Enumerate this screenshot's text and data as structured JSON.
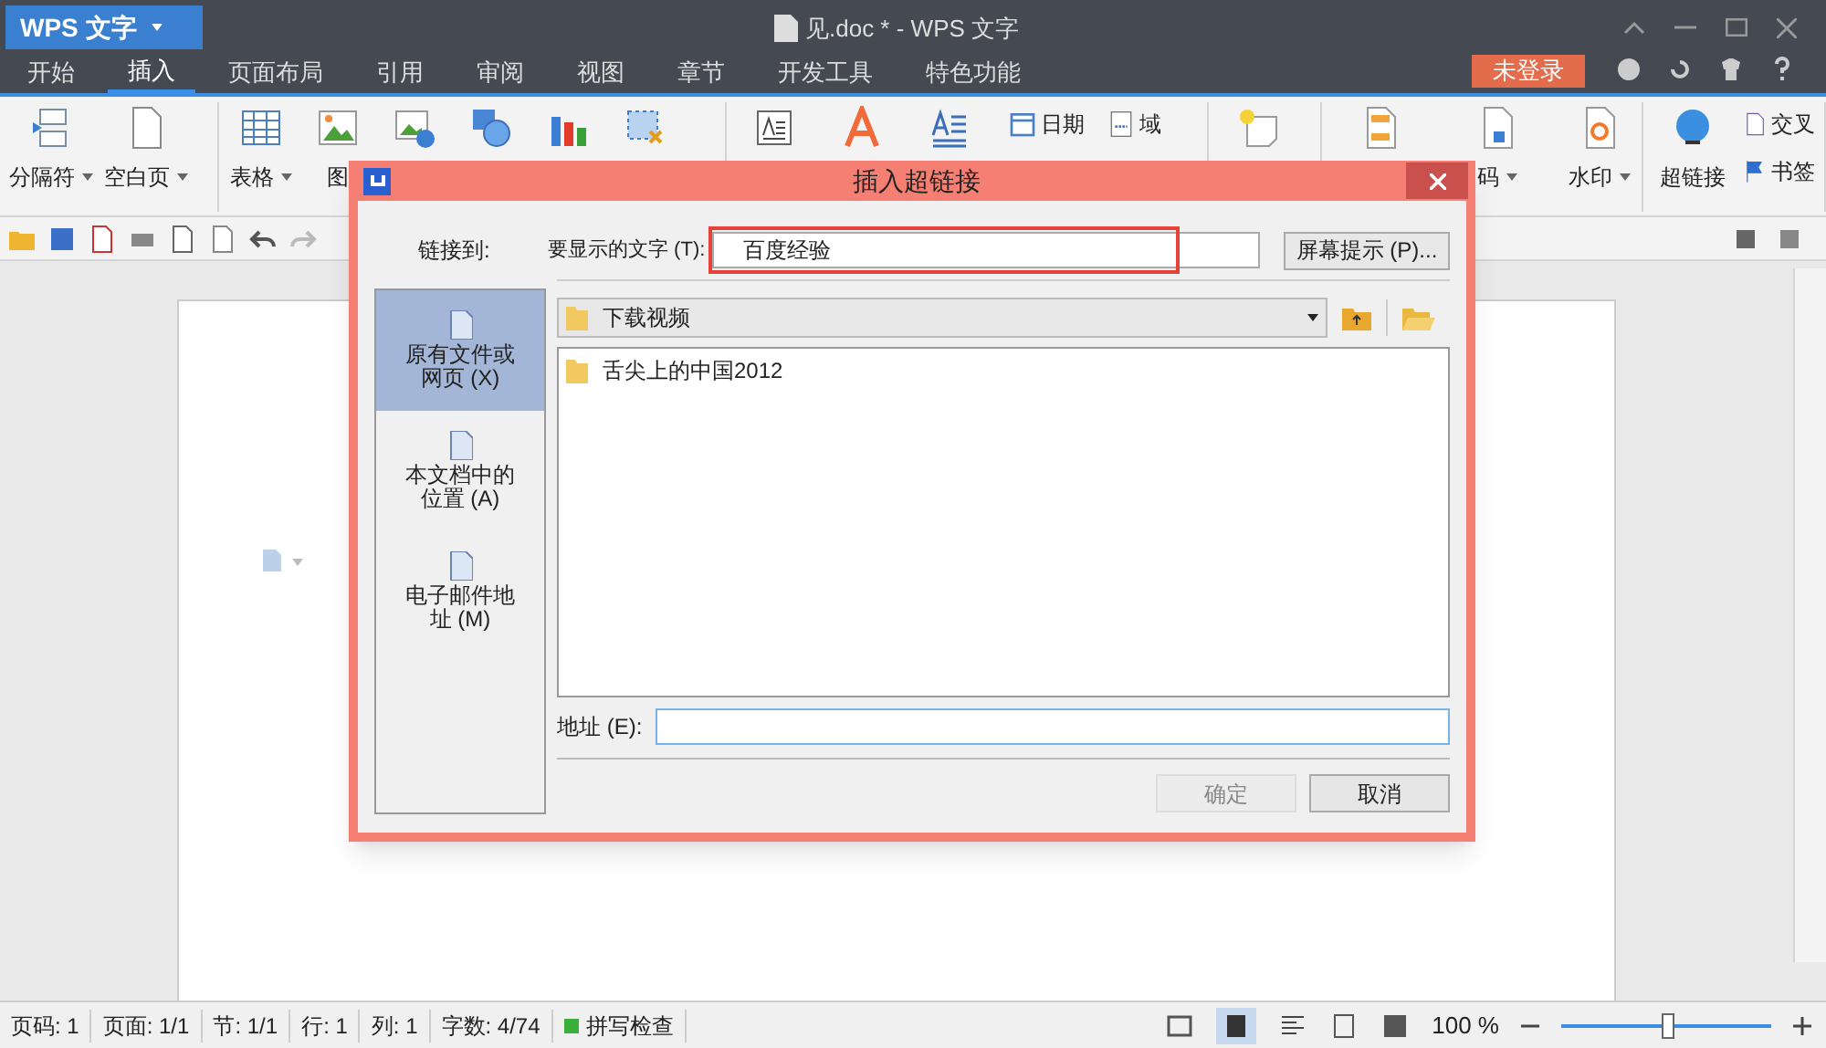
{
  "app": {
    "menu_button": "WPS 文字",
    "title": "见.doc * - WPS 文字",
    "login": "未登录"
  },
  "tabs": [
    {
      "label": "开始",
      "selected": false
    },
    {
      "label": "插入",
      "selected": true
    },
    {
      "label": "页面布局",
      "selected": false
    },
    {
      "label": "引用",
      "selected": false
    },
    {
      "label": "审阅",
      "selected": false
    },
    {
      "label": "视图",
      "selected": false
    },
    {
      "label": "章节",
      "selected": false
    },
    {
      "label": "开发工具",
      "selected": false
    },
    {
      "label": "特色功能",
      "selected": false
    }
  ],
  "ribbon_groups": [
    [
      {
        "kind": "large",
        "label": "分隔符",
        "dropdown": true
      },
      {
        "kind": "large",
        "label": "空白页",
        "dropdown": true
      }
    ],
    [
      {
        "kind": "large",
        "label": "表格",
        "dropdown": true
      },
      {
        "kind": "large",
        "label": "图",
        "dropdown": false
      },
      {
        "kind": "large"
      },
      {
        "kind": "large"
      },
      {
        "kind": "large"
      },
      {
        "kind": "large"
      }
    ],
    [
      {
        "kind": "large"
      },
      {
        "kind": "large"
      },
      {
        "kind": "large"
      },
      {
        "kind": "small",
        "label": "日期"
      },
      {
        "kind": "small",
        "label": "域"
      }
    ],
    [
      {
        "kind": "large"
      }
    ],
    [
      {
        "kind": "large"
      },
      {
        "kind": "large",
        "label": "码",
        "dropdown": true
      },
      {
        "kind": "large",
        "label": "水印",
        "dropdown": true
      }
    ],
    [
      {
        "kind": "large",
        "label": "超链接",
        "dropdown": false
      },
      {
        "kind": "stacked",
        "label": "交叉"
      },
      {
        "kind": "stacked",
        "label": "书签"
      }
    ]
  ],
  "dialog": {
    "title": "插入超链接",
    "link_to_label": "链接到:",
    "display_text_label": "要显示的文字 (T):",
    "display_text_value": "百度经验",
    "screen_tip_button": "屏幕提示 (P)...",
    "link_types": [
      {
        "label": "原有文件或网页 (X)",
        "selected": true
      },
      {
        "label": "本文档中的位置 (A)",
        "selected": false
      },
      {
        "label": "电子邮件地址 (M)",
        "selected": false
      }
    ],
    "folder": "下载视频",
    "files": [
      "舌尖上的中国2012"
    ],
    "address_label": "地址 (E):",
    "buttons": [
      {
        "label": "确定",
        "disabled": true
      },
      {
        "label": "取消",
        "disabled": false
      }
    ]
  },
  "status_bar": {
    "items": [
      "页码: 1",
      "页面: 1/1",
      "节: 1/1",
      "行: 1",
      "列: 1",
      "字数: 4/74"
    ],
    "spell_check": "拼写检查",
    "zoom": "100 %",
    "zoom_slider": {
      "level": 0.5
    }
  }
}
